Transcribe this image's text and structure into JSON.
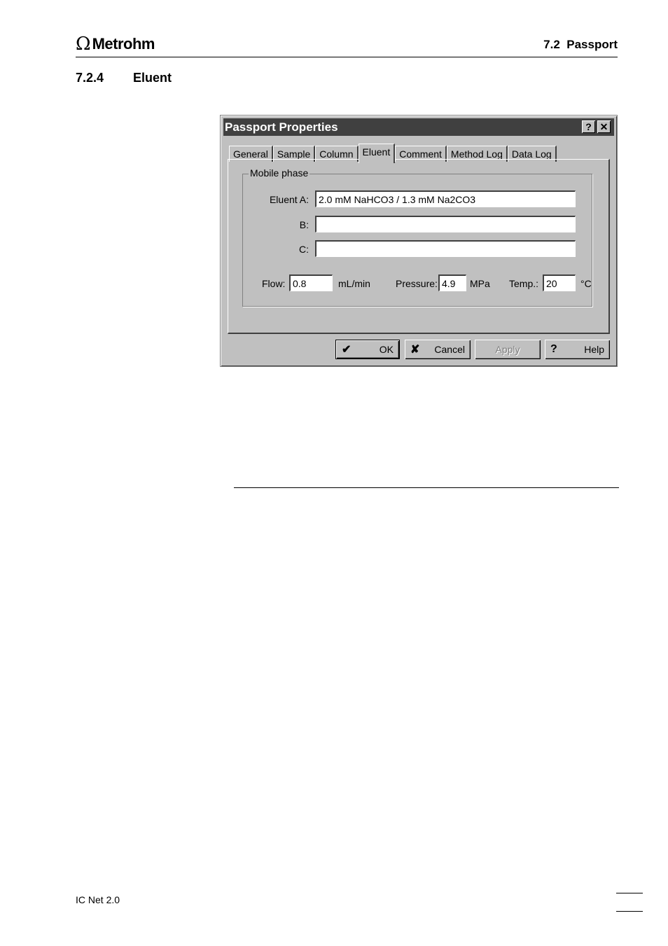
{
  "header": {
    "logo_symbol": "Ω",
    "logo_text": "Metrohm",
    "section_ref": "7.2  Passport"
  },
  "section": {
    "number": "7.2.4",
    "title": "Eluent"
  },
  "dialog": {
    "title": "Passport Properties",
    "help_glyph": "?",
    "close_glyph": "✕",
    "tabs": [
      "General",
      "Sample",
      "Column",
      "Eluent",
      "Comment",
      "Method Log",
      "Data Log"
    ],
    "active_tab": "Eluent",
    "group_label": "Mobile phase",
    "eluent_a_label": "Eluent A:",
    "eluent_a_value": "2.0 mM NaHCO3 / 1.3 mM Na2CO3",
    "eluent_b_label": "B:",
    "eluent_b_value": "",
    "eluent_c_label": "C:",
    "eluent_c_value": "",
    "flow_label": "Flow:",
    "flow_value": "0.8",
    "flow_unit": "mL/min",
    "pressure_label": "Pressure:",
    "pressure_value": "4.9",
    "pressure_unit": "MPa",
    "temp_label": "Temp.:",
    "temp_value": "20",
    "temp_unit": "°C",
    "buttons": {
      "ok": "OK",
      "cancel": "Cancel",
      "apply": "Apply",
      "help": "Help"
    }
  },
  "footer": {
    "product": "IC Net 2.0"
  }
}
